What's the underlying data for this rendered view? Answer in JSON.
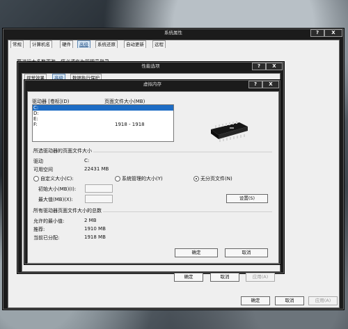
{
  "system_props": {
    "title": "系统属性",
    "tabs": [
      "常规",
      "计算机名",
      "硬件",
      "高级",
      "系统还原",
      "自动更新",
      "远程"
    ],
    "active_tab": 3,
    "hint": "要进行大多数更改，您必须作为管理员登录。",
    "buttons": {
      "ok": "确定",
      "cancel": "取消",
      "apply": "应用(A)"
    },
    "controls": {
      "help": "?",
      "close": "X"
    }
  },
  "perf_options": {
    "title": "性能选项",
    "tabs": [
      "视觉效果",
      "高级",
      "数据执行保护"
    ],
    "buttons": {
      "ok": "确定",
      "cancel": "取消",
      "apply": "应用(A)"
    },
    "controls": {
      "help": "?",
      "close": "X"
    }
  },
  "virtual_memory": {
    "title": "虚拟内存",
    "controls": {
      "help": "?",
      "close": "X"
    },
    "drive_col": "驱动器 [卷标](D)",
    "pagefile_col": "页面文件大小(MB)",
    "drives": [
      {
        "drive": "C:",
        "size": ""
      },
      {
        "drive": "D:",
        "size": ""
      },
      {
        "drive": "E:",
        "size": ""
      },
      {
        "drive": "F:",
        "size": "1918 - 1918"
      }
    ],
    "selected_drive_index": 0,
    "selected_group": {
      "title": "所选驱动器的页面文件大小",
      "drive_label": "驱动",
      "drive_value": "C:",
      "space_label": "可用空间",
      "space_value": "22431 MB",
      "custom_label": "自定义大小(C):",
      "initial_label": "初始大小(MB)(I):",
      "max_label": "最大值(MB)(X):",
      "system_managed_label": "系统管理的大小(Y)",
      "no_pagefile_label": "无分页文件(N)",
      "selected_option": "no_pagefile",
      "set_button": "设置(S)"
    },
    "total_group": {
      "title": "所有驱动器页面文件大小的总数",
      "min_label": "允许的最小值:",
      "min_value": "2 MB",
      "rec_label": "推荐:",
      "rec_value": "1910 MB",
      "cur_label": "当前已分配:",
      "cur_value": "1918 MB"
    },
    "buttons": {
      "ok": "确定",
      "cancel": "取消"
    }
  }
}
